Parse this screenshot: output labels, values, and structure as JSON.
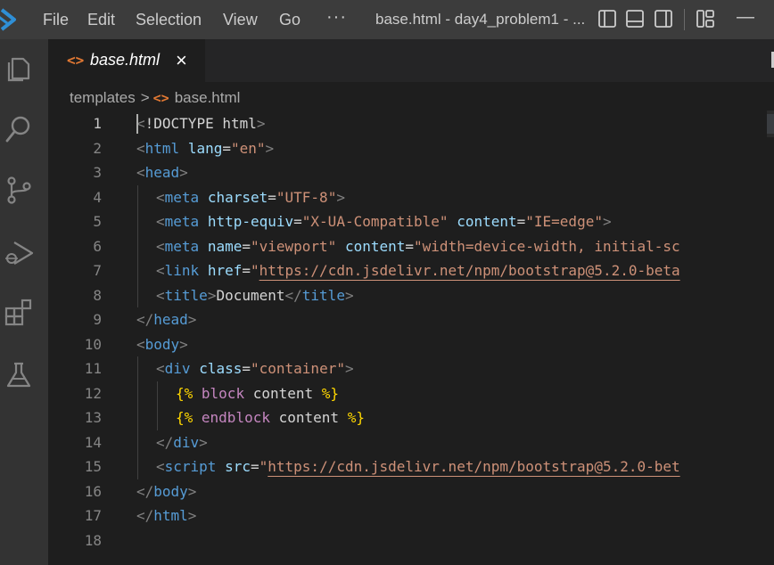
{
  "titlebar": {
    "menu": [
      "File",
      "Edit",
      "Selection",
      "View",
      "Go"
    ],
    "more": "···",
    "title": "base.html - day4_problem1 - ...",
    "minimize": "—"
  },
  "tabs": [
    {
      "icon": "<>",
      "label": "base.html",
      "close": "×",
      "active": true
    }
  ],
  "breadcrumb": {
    "folder": "templates",
    "separator": ">",
    "file_icon": "<>",
    "file": "base.html"
  },
  "editor": {
    "active_line": 1,
    "lines": [
      {
        "number": "1",
        "indent": 0,
        "tokens": [
          [
            "bracket",
            "<"
          ],
          [
            "text",
            "!DOCTYPE html"
          ],
          [
            "bracket",
            ">"
          ]
        ]
      },
      {
        "number": "2",
        "indent": 0,
        "tokens": [
          [
            "bracket",
            "<"
          ],
          [
            "tag",
            "html"
          ],
          [
            "text",
            " "
          ],
          [
            "attr",
            "lang"
          ],
          [
            "eq",
            "="
          ],
          [
            "str",
            "\"en\""
          ],
          [
            "bracket",
            ">"
          ]
        ]
      },
      {
        "number": "3",
        "indent": 0,
        "tokens": [
          [
            "bracket",
            "<"
          ],
          [
            "tag",
            "head"
          ],
          [
            "bracket",
            ">"
          ]
        ]
      },
      {
        "number": "4",
        "indent": 1,
        "tokens": [
          [
            "bracket",
            "<"
          ],
          [
            "tag",
            "meta"
          ],
          [
            "text",
            " "
          ],
          [
            "attr",
            "charset"
          ],
          [
            "eq",
            "="
          ],
          [
            "str",
            "\"UTF-8\""
          ],
          [
            "bracket",
            ">"
          ]
        ]
      },
      {
        "number": "5",
        "indent": 1,
        "tokens": [
          [
            "bracket",
            "<"
          ],
          [
            "tag",
            "meta"
          ],
          [
            "text",
            " "
          ],
          [
            "attr",
            "http-equiv"
          ],
          [
            "eq",
            "="
          ],
          [
            "str",
            "\"X-UA-Compatible\""
          ],
          [
            "text",
            " "
          ],
          [
            "attr",
            "content"
          ],
          [
            "eq",
            "="
          ],
          [
            "str",
            "\"IE=edge\""
          ],
          [
            "bracket",
            ">"
          ]
        ]
      },
      {
        "number": "6",
        "indent": 1,
        "tokens": [
          [
            "bracket",
            "<"
          ],
          [
            "tag",
            "meta"
          ],
          [
            "text",
            " "
          ],
          [
            "attr",
            "name"
          ],
          [
            "eq",
            "="
          ],
          [
            "str",
            "\"viewport\""
          ],
          [
            "text",
            " "
          ],
          [
            "attr",
            "content"
          ],
          [
            "eq",
            "="
          ],
          [
            "str",
            "\"width=device-width, initial-sc"
          ]
        ]
      },
      {
        "number": "7",
        "indent": 1,
        "tokens": [
          [
            "bracket",
            "<"
          ],
          [
            "tag",
            "link"
          ],
          [
            "text",
            " "
          ],
          [
            "attr",
            "href"
          ],
          [
            "eq",
            "="
          ],
          [
            "str",
            "\""
          ],
          [
            "link",
            "https://cdn.jsdelivr.net/npm/bootstrap@5.2.0-beta"
          ]
        ]
      },
      {
        "number": "8",
        "indent": 1,
        "tokens": [
          [
            "bracket",
            "<"
          ],
          [
            "tag",
            "title"
          ],
          [
            "bracket",
            ">"
          ],
          [
            "text",
            "Document"
          ],
          [
            "bracket",
            "</"
          ],
          [
            "tag",
            "title"
          ],
          [
            "bracket",
            ">"
          ]
        ]
      },
      {
        "number": "9",
        "indent": 0,
        "tokens": [
          [
            "bracket",
            "</"
          ],
          [
            "tag",
            "head"
          ],
          [
            "bracket",
            ">"
          ]
        ]
      },
      {
        "number": "10",
        "indent": 0,
        "tokens": [
          [
            "bracket",
            "<"
          ],
          [
            "tag",
            "body"
          ],
          [
            "bracket",
            ">"
          ]
        ]
      },
      {
        "number": "11",
        "indent": 1,
        "tokens": [
          [
            "bracket",
            "<"
          ],
          [
            "tag",
            "div"
          ],
          [
            "text",
            " "
          ],
          [
            "attr",
            "class"
          ],
          [
            "eq",
            "="
          ],
          [
            "str",
            "\"container\""
          ],
          [
            "bracket",
            ">"
          ]
        ]
      },
      {
        "number": "12",
        "indent": 2,
        "tokens": [
          [
            "jinja",
            "{%"
          ],
          [
            "text",
            " "
          ],
          [
            "kw",
            "block"
          ],
          [
            "text",
            " "
          ],
          [
            "var",
            "content"
          ],
          [
            "text",
            " "
          ],
          [
            "jinja",
            "%}"
          ]
        ]
      },
      {
        "number": "13",
        "indent": 2,
        "tokens": [
          [
            "jinja",
            "{%"
          ],
          [
            "text",
            " "
          ],
          [
            "kw",
            "endblock"
          ],
          [
            "text",
            " "
          ],
          [
            "var",
            "content"
          ],
          [
            "text",
            " "
          ],
          [
            "jinja",
            "%}"
          ]
        ]
      },
      {
        "number": "14",
        "indent": 1,
        "tokens": [
          [
            "bracket",
            "</"
          ],
          [
            "tag",
            "div"
          ],
          [
            "bracket",
            ">"
          ]
        ]
      },
      {
        "number": "15",
        "indent": 1,
        "tokens": [
          [
            "bracket",
            "<"
          ],
          [
            "tag",
            "script"
          ],
          [
            "text",
            " "
          ],
          [
            "attr",
            "src"
          ],
          [
            "eq",
            "="
          ],
          [
            "str",
            "\""
          ],
          [
            "link",
            "https://cdn.jsdelivr.net/npm/bootstrap@5.2.0-bet"
          ]
        ]
      },
      {
        "number": "16",
        "indent": 0,
        "tokens": [
          [
            "bracket",
            "</"
          ],
          [
            "tag",
            "body"
          ],
          [
            "bracket",
            ">"
          ]
        ]
      },
      {
        "number": "17",
        "indent": 0,
        "tokens": [
          [
            "bracket",
            "</"
          ],
          [
            "tag",
            "html"
          ],
          [
            "bracket",
            ">"
          ]
        ]
      },
      {
        "number": "18",
        "indent": 0,
        "tokens": []
      }
    ]
  },
  "icons": {
    "app_logo": "vscode-logo-icon",
    "layout": [
      "toggle-primary-sidebar-icon",
      "toggle-panel-icon",
      "toggle-secondary-sidebar-icon",
      "customize-layout-icon"
    ],
    "activity": [
      "explorer-icon",
      "search-icon",
      "source-control-icon",
      "run-debug-icon",
      "extensions-icon",
      "testing-icon"
    ]
  },
  "colors": {
    "tag": "#569cd6",
    "attribute": "#9cdcfe",
    "string": "#ce9178",
    "jinja_delimiter": "#ffd700",
    "keyword": "#c586c0",
    "file_icon": "#e37933",
    "logo": "#2f8fd6"
  }
}
